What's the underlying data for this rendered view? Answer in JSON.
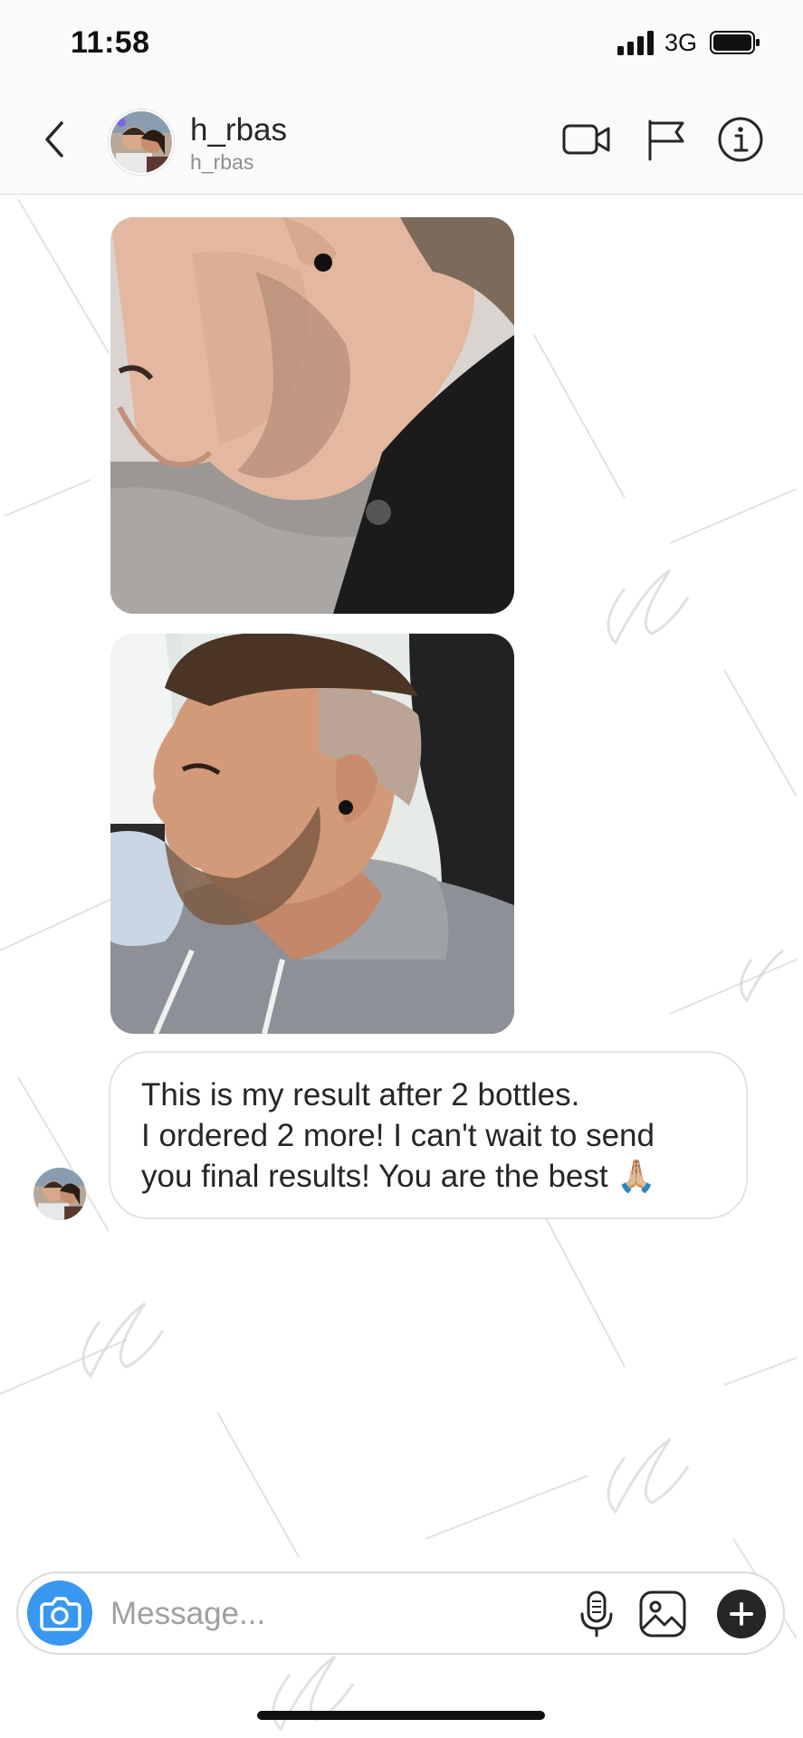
{
  "status_bar": {
    "time": "11:58",
    "network": "3G"
  },
  "header": {
    "username": "h_rbas",
    "subtitle": "h_rbas",
    "icons": [
      "back-chevron-icon",
      "video-call-icon",
      "flag-icon",
      "info-icon"
    ]
  },
  "thread": {
    "photos": [
      {
        "description_icon": "photo-message-before"
      },
      {
        "description_icon": "photo-message-after"
      }
    ],
    "message": {
      "lines": [
        "This is my result after 2 bottles.",
        "I ordered 2 more! I can't wait to send",
        "you final results! You are the best 🙏🏼"
      ]
    }
  },
  "composer": {
    "placeholder": "Message...",
    "icons": [
      "camera-icon",
      "microphone-icon",
      "gallery-icon",
      "plus-icon"
    ]
  },
  "colors": {
    "camera_button": "#3897f0",
    "header_bg": "#fafafa",
    "bubble_border": "#e3e3e3",
    "muted_text": "#8e8e8e"
  }
}
